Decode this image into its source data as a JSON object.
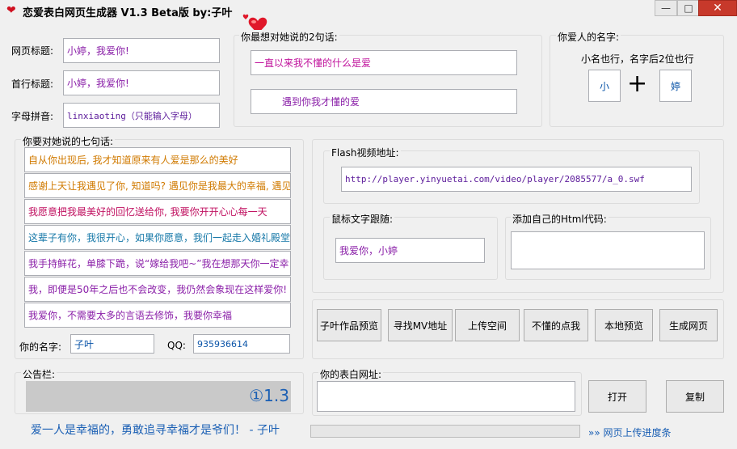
{
  "window": {
    "title": "恋爱表白网页生成器 V1.3 Beta版  by:子叶",
    "minimize_glyph": "—",
    "maximize_glyph": "□",
    "close_glyph": "✕"
  },
  "basic": {
    "page_title_label": "网页标题:",
    "page_title_value": "小婷，我爱你!",
    "first_line_label": "首行标题:",
    "first_line_value": "小婷，我爱你!",
    "pinyin_label": "字母拼音:",
    "pinyin_value": "linxiaoting（只能输入字母）"
  },
  "two_sentences": {
    "label": "你最想对她说的2句话:",
    "line1": "一直以来我不懂的什么是爱",
    "line2": "遇到你我才懂的爱"
  },
  "lover_name": {
    "label": "你爱人的名字:",
    "hint": "小名也行，名字后2位也行",
    "char1": "小",
    "plus": "+",
    "char2": "婷"
  },
  "seven_sentences": {
    "label": "你要对她说的七句话:",
    "lines": [
      "自从你出现后, 我才知道原来有人爱是那么的美好",
      "感谢上天让我遇见了你, 知道吗? 遇见你是我最大的幸福, 遇见",
      "我愿意把我最美好的回忆送给你, 我要你开开心心每一天",
      "这辈子有你，我很开心，如果你愿意，我们一起走入婚礼殿堂",
      "我手持鲜花，单膝下跪，说“嫁给我吧~”我在想那天你一定幸",
      "我，即便是50年之后也不会改变，我仍然会象现在这样爱你!",
      "我爱你，不需要太多的言语去修饰，我要你幸福"
    ]
  },
  "author": {
    "name_label": "你的名字:",
    "name_value": "子叶",
    "qq_label": "QQ:",
    "qq_value": "935936614"
  },
  "flash": {
    "label": "Flash视频地址:",
    "url": "http://player.yinyuetai.com/video/player/2085577/a_0.swf"
  },
  "mouse_text": {
    "label": "鼠标文字跟随:",
    "value": "我爱你，小婷"
  },
  "html_code": {
    "label": "添加自己的Html代码:",
    "value": ""
  },
  "buttons": {
    "works": "子叶作品预览",
    "find_mv": "寻找MV地址",
    "upload": "上传空间",
    "help": "不懂的点我",
    "local_preview": "本地预览",
    "generate": "生成网页"
  },
  "notice": {
    "label": "公告栏:",
    "text": "①1.3"
  },
  "confession_url": {
    "label": "你的表白网址:",
    "value": ""
  },
  "actions": {
    "open": "打开",
    "copy": "复制"
  },
  "footer": {
    "slogan": "爱一人是幸福的，勇敢追寻幸福才是爷们！ - 子叶",
    "progress_label": "»» 网页上传进度条",
    "progress_value": 0
  },
  "colors": {
    "heart": "#e0182a",
    "close": "#c7392b",
    "accent_blue": "#1a5fb4"
  }
}
